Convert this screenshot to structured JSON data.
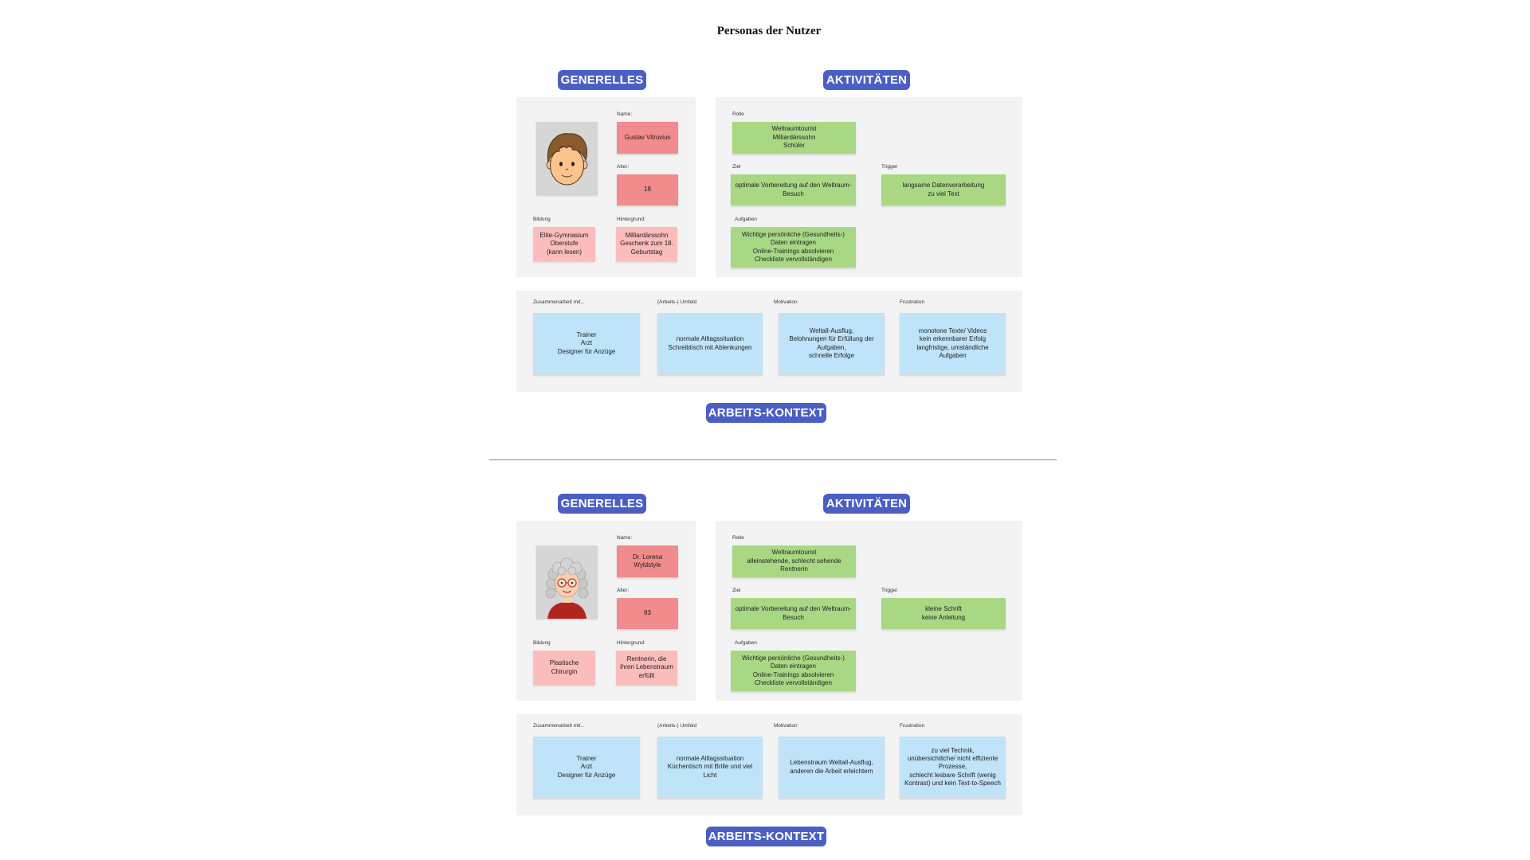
{
  "title": "Personas der Nutzer",
  "colors": {
    "badge": "#4b5fc3",
    "panel": "#f3f3f3",
    "sticky_red": "#f28b8b",
    "sticky_pink": "#fbbcbc",
    "sticky_green": "#a9d884",
    "sticky_blue": "#bfe3f9"
  },
  "personas": [
    {
      "avatar_icon": "young-man-avatar-icon",
      "generelles_label": "GENERELLES",
      "aktivitaeten_label": "AKTIVITÄTEN",
      "kontext_label": "ARBEITS-KONTEXT",
      "name": {
        "label": "Name:",
        "value": "Gustav Vitruvius"
      },
      "alter": {
        "label": "Alter:",
        "value": "18"
      },
      "bildung": {
        "label": "Bildung",
        "value": "Elite-Gymnasium\nOberstufe\n(kann lesen)"
      },
      "hintergrund": {
        "label": "Hintergrund:",
        "value": "Milliardärssohn\nGeschenk zum 18.\nGeburtstag"
      },
      "rolle": {
        "label": "Rolle",
        "value": "Weltraumtourist\nMilliardärssohn\nSchüler"
      },
      "ziel": {
        "label": "Ziel",
        "value": "optimale Vorbereitung auf den Weltraum-\nBesuch"
      },
      "trigger": {
        "label": "Trigger",
        "value": "langsame Datenverarbeitung\nzu viel Text"
      },
      "aufgaben": {
        "label": "Aufgaben",
        "value": "Wichtige persönliche (Gesundheits-)\nDaten eintragen\nOnline-Trainings absolvieren\nCheckliste vervollständigen"
      },
      "zusammenarbeit": {
        "label": "Zusammenarbeit mit...",
        "value": "Trainer\nArzt\nDesigner für Anzüge"
      },
      "umfeld": {
        "label": "(Arbeits-) Umfeld",
        "value": "normale Alltagssituation\nSchreibtisch mit Ablenkungen"
      },
      "motivation": {
        "label": "Motivation",
        "value": "Weltall-Ausflug,\nBelohnungen für Erfüllung der\nAufgaben,\nschnelle Erfolge"
      },
      "frustration": {
        "label": "Frustration",
        "value": "monotone Texte/ Videos\nkein erkennbarer Erfolg\nlangfristige, umständliche\nAufgaben"
      }
    },
    {
      "avatar_icon": "elderly-woman-avatar-icon",
      "generelles_label": "GENERELLES",
      "aktivitaeten_label": "AKTIVITÄTEN",
      "kontext_label": "ARBEITS-KONTEXT",
      "name": {
        "label": "Name:",
        "value": "Dr. Lorena\nWyldstyle"
      },
      "alter": {
        "label": "Alter:",
        "value": "83"
      },
      "bildung": {
        "label": "Bildung",
        "value": "Plastische\nChirurgin"
      },
      "hintergrund": {
        "label": "Hintergrund:",
        "value": "Rentnerin, die\nihren Lebenstraum\nerfüllt"
      },
      "rolle": {
        "label": "Rolle",
        "value": "Weltraumtourist\nalleinstehende, schlecht sehende\nRentnerin"
      },
      "ziel": {
        "label": "Ziel",
        "value": "optimale Vorbereitung auf den Weltraum-\nBesuch"
      },
      "trigger": {
        "label": "Trigger",
        "value": "kleine Schrift\nkeine Anleitung"
      },
      "aufgaben": {
        "label": "Aufgaben",
        "value": "Wichtige persönliche (Gesundheits-)\nDaten eintragen\nOnline-Trainings absolvieren\nCheckliste vervollständigen"
      },
      "zusammenarbeit": {
        "label": "Zusammenarbeit mit...",
        "value": "Trainer\nArzt\nDesigner für Anzüge"
      },
      "umfeld": {
        "label": "(Arbeits-) Umfeld",
        "value": "normale Alltagssituation\nKüchentisch mit Brille und viel\nLicht"
      },
      "motivation": {
        "label": "Motivation",
        "value": "Lebenstraum Weltall-Ausflug,\nanderen die Arbeit erleichtern"
      },
      "frustration": {
        "label": "Frustration",
        "value": "zu viel Technik,\nunübersichtliche/ nicht effiziente\nProzesse,\nschlecht lesbare Schrift (wenig\nKontrast) und kein Text-to-Speech"
      }
    }
  ]
}
